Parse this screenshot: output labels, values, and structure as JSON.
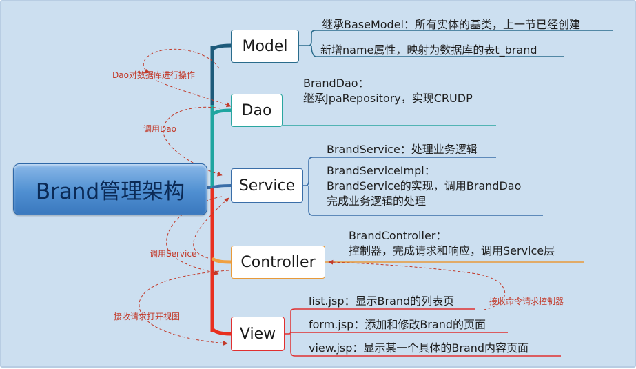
{
  "root": "Brand管理架构",
  "nodes": {
    "model": "Model",
    "dao": "Dao",
    "service": "Service",
    "controller": "Controller",
    "view": "View"
  },
  "details": {
    "model_1": "继承BaseModel：所有实体的基类，上一节已经创建",
    "model_2": "新增name属性，映射为数据库的表t_brand",
    "dao_1": "BrandDao：",
    "dao_2": "继承JpaRepository，实现CRUDP",
    "service_1": "BrandService：处理业务逻辑",
    "service_2": "BrandServiceImpl：",
    "service_3": "BrandService的实现，调用BrandDao",
    "service_4": "完成业务逻辑的处理",
    "controller_1": "BrandController：",
    "controller_2": "控制器，完成请求和响应，调用Service层",
    "view_1": "list.jsp：显示Brand的列表页",
    "view_2": "form.jsp：添加和修改Brand的页面",
    "view_3": "view.jsp：显示某一个具体的Brand内容页面"
  },
  "annotations": {
    "dao_ops": "Dao对数据库进行操作",
    "call_dao": "调用Dao",
    "call_service": "调用Service",
    "receive_command": "接收命令请求控制器",
    "receive_view": "接收请求打开视图"
  },
  "colors": {
    "background": "#ccdff0",
    "model_branch": "#1d5a7a",
    "dao_branch": "#1fa5a0",
    "service_branch": "#3a6ea8",
    "controller_branch": "#f0a040",
    "view_branch": "#e83020",
    "annotation_text": "#c23a2a"
  }
}
